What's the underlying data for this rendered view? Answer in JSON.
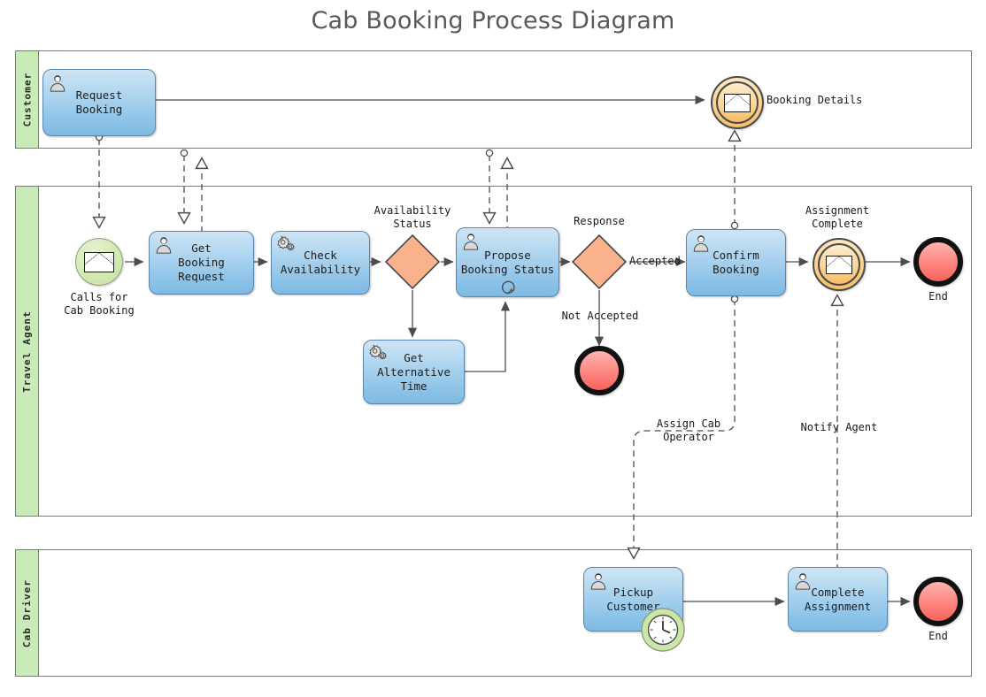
{
  "title": "Cab Booking Process Diagram",
  "colors": {
    "lane_header": "#c9ebb8",
    "task_fill": "#9ccbe9",
    "task_border": "#5c87ad",
    "gateway_fill": "#f9b28c",
    "gateway_border": "#4a4a4a",
    "start_event_fill": "#c9e5a6",
    "intermediate_event_fill": "#fbd394",
    "end_event_fill": "#fb8a85",
    "pool_border": "#7b7b7b",
    "title_color": "#595959"
  },
  "pools": [
    {
      "id": "customer",
      "label": "Customer"
    },
    {
      "id": "travel_agent",
      "label": "Travel Agent"
    },
    {
      "id": "cab_driver",
      "label": "Cab Driver"
    }
  ],
  "nodes": {
    "request_booking": {
      "label": "Request\nBooking",
      "type": "user-task",
      "lane": "customer"
    },
    "booking_details": {
      "label": "Booking Details",
      "type": "intermediate-message-event",
      "lane": "customer"
    },
    "calls_for_cab": {
      "label": "Calls for\nCab Booking",
      "type": "message-start-event",
      "lane": "travel_agent"
    },
    "get_booking_request": {
      "label": "Get\nBooking\nRequest",
      "type": "user-task",
      "lane": "travel_agent"
    },
    "check_availability": {
      "label": "Check\nAvailability",
      "type": "service-task",
      "lane": "travel_agent"
    },
    "availability_status": {
      "label": "Availability\nStatus",
      "type": "exclusive-gateway",
      "lane": "travel_agent"
    },
    "get_alternative_time": {
      "label": "Get\nAlternative\nTime",
      "type": "service-task",
      "lane": "travel_agent"
    },
    "propose_booking_status": {
      "label": "Propose\nBooking Status",
      "type": "user-task-loop",
      "lane": "travel_agent"
    },
    "response": {
      "label": "Response",
      "type": "exclusive-gateway",
      "lane": "travel_agent"
    },
    "not_accepted_end": {
      "label": "",
      "type": "end-event",
      "lane": "travel_agent"
    },
    "confirm_booking": {
      "label": "Confirm\nBooking",
      "type": "user-task",
      "lane": "travel_agent"
    },
    "assignment_complete": {
      "label": "Assignment\nComplete",
      "type": "intermediate-message-event",
      "lane": "travel_agent"
    },
    "travel_agent_end": {
      "label": "End",
      "type": "end-event",
      "lane": "travel_agent"
    },
    "pickup_customer": {
      "label": "Pickup\nCustomer",
      "type": "user-task-timer",
      "lane": "cab_driver"
    },
    "complete_assignment": {
      "label": "Complete\nAssignment",
      "type": "user-task",
      "lane": "cab_driver"
    },
    "cab_driver_end": {
      "label": "End",
      "type": "end-event",
      "lane": "cab_driver"
    }
  },
  "edge_labels": {
    "accepted": "Accepted",
    "not_accepted": "Not Accepted",
    "assign_cab_operator": "Assign Cab\nOperator",
    "notify_agent": "Notify Agent"
  },
  "icons": {
    "user_task": "user-icon",
    "service_task": "gear-icon",
    "message": "envelope-icon",
    "loop": "loop-icon",
    "timer": "clock-icon"
  }
}
